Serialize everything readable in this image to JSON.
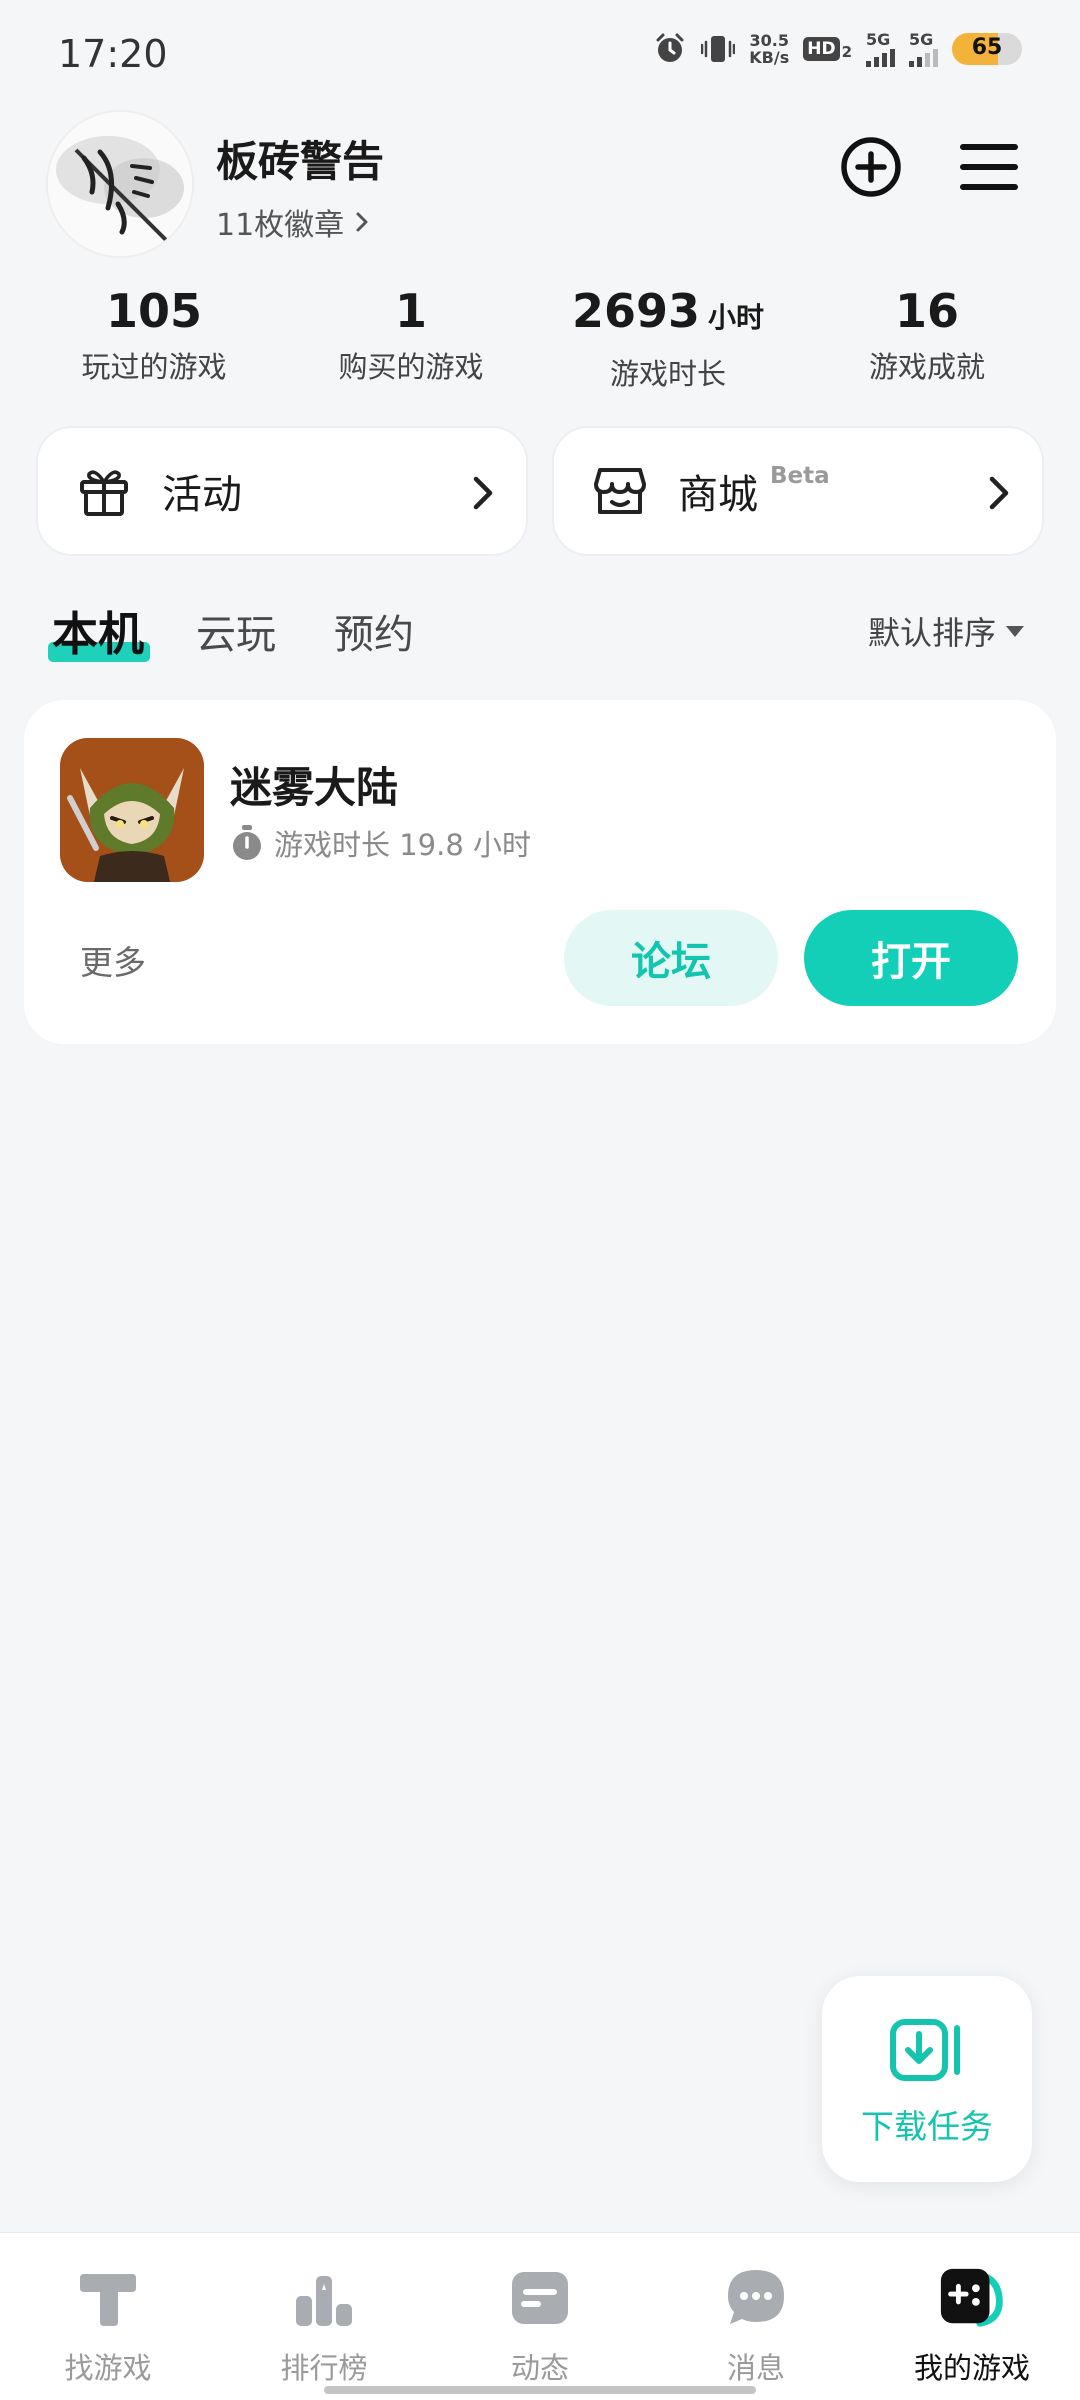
{
  "status_bar": {
    "time": "17:20",
    "net_speed_value": "30.5",
    "net_speed_unit": "KB/s",
    "hd_label": "HD",
    "hd_sub": "2",
    "sim1_label": "5G",
    "sim2_label": "5G",
    "battery_level": 65,
    "battery_text": "65",
    "icons": [
      "alarm-icon",
      "vibrate-icon",
      "hd-icon",
      "signal-icon",
      "signal-icon",
      "battery-icon"
    ]
  },
  "profile": {
    "username": "板砖警告",
    "badges_text": "11枚徽章",
    "avatar_icon": "avatar-calligraphy"
  },
  "stats": [
    {
      "value": "105",
      "unit": "",
      "label": "玩过的游戏"
    },
    {
      "value": "1",
      "unit": "",
      "label": "购买的游戏"
    },
    {
      "value": "2693",
      "unit": "小时",
      "label": "游戏时长"
    },
    {
      "value": "16",
      "unit": "",
      "label": "游戏成就"
    }
  ],
  "quick_cards": {
    "activity": {
      "label": "活动",
      "icon": "gift-icon"
    },
    "store": {
      "label": "商城",
      "badge": "Beta",
      "icon": "store-icon"
    }
  },
  "tabs": {
    "items": [
      "本机",
      "云玩",
      "预约"
    ],
    "active_index": 0,
    "sort_label": "默认排序"
  },
  "game": {
    "name": "迷雾大陆",
    "play_time": "游戏时长 19.8 小时",
    "more_label": "更多",
    "forum_label": "论坛",
    "open_label": "打开"
  },
  "fab": {
    "label": "下载任务",
    "icon": "download-task-icon"
  },
  "bottom_nav": {
    "items": [
      {
        "label": "找游戏",
        "icon": "find-game-icon"
      },
      {
        "label": "排行榜",
        "icon": "ranking-icon"
      },
      {
        "label": "动态",
        "icon": "feed-icon"
      },
      {
        "label": "消息",
        "icon": "message-icon"
      },
      {
        "label": "我的游戏",
        "icon": "my-games-icon"
      }
    ],
    "active_index": 4
  },
  "colors": {
    "accent": "#14cfb8",
    "accent_light": "#e3f8f5",
    "background": "#f5f6f8",
    "battery": "#f3b23a"
  }
}
